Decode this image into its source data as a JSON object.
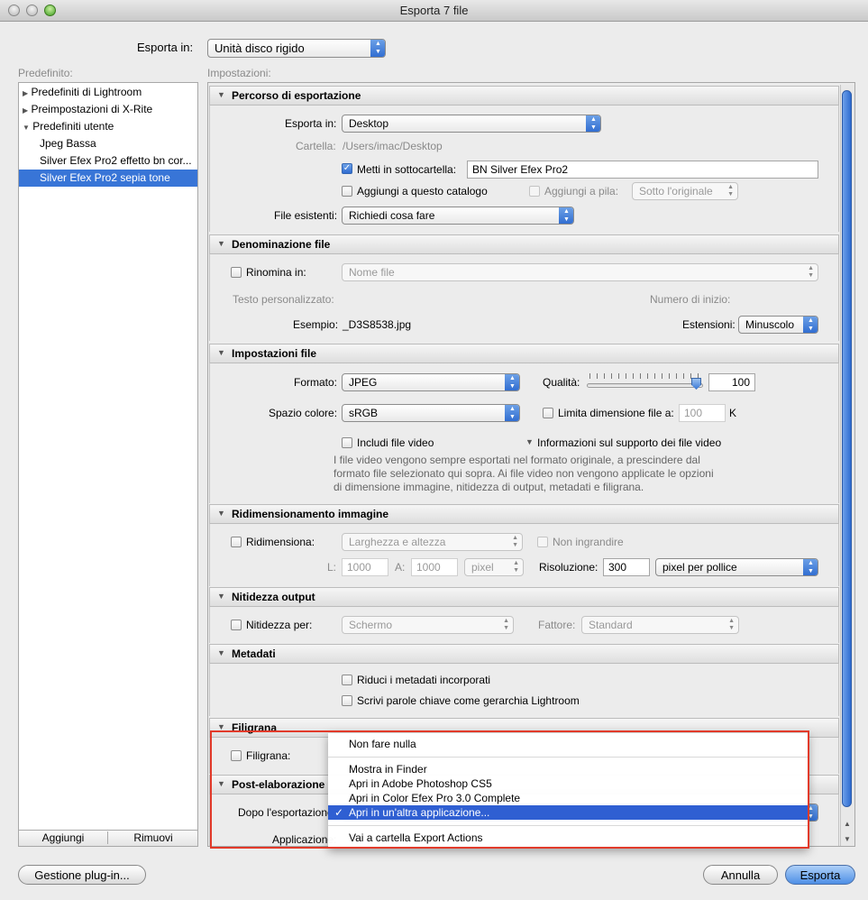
{
  "window": {
    "title": "Esporta 7 file"
  },
  "export_to": {
    "label": "Esporta in:",
    "value": "Unità disco rigido"
  },
  "presets": {
    "header": "Predefinito:",
    "items": [
      {
        "label": "Predefiniti di Lightroom",
        "kind": "folder-closed"
      },
      {
        "label": "Preimpostazioni di X-Rite",
        "kind": "folder-closed"
      },
      {
        "label": "Predefiniti utente",
        "kind": "folder-open"
      },
      {
        "label": "Jpeg Bassa",
        "kind": "item"
      },
      {
        "label": "Silver Efex Pro2 effetto bn cor...",
        "kind": "item"
      },
      {
        "label": "Silver Efex Pro2 sepia tone",
        "kind": "selected"
      }
    ],
    "add_label": "Aggiungi",
    "remove_label": "Rimuovi"
  },
  "settings_header": "Impostazioni:",
  "export_location": {
    "title": "Percorso di esportazione",
    "export_in_label": "Esporta in:",
    "export_in_value": "Desktop",
    "folder_label": "Cartella:",
    "folder_value": "/Users/imac/Desktop",
    "subfolder_label": "Metti in sottocartella:",
    "subfolder_value": "BN Silver Efex Pro2",
    "add_catalog_label": "Aggiungi a questo catalogo",
    "add_stack_label": "Aggiungi a pila:",
    "stack_value": "Sotto l'originale",
    "existing_label": "File esistenti:",
    "existing_value": "Richiedi cosa fare"
  },
  "file_naming": {
    "title": "Denominazione file",
    "rename_label": "Rinomina in:",
    "rename_value": "Nome file",
    "custom_text_label": "Testo personalizzato:",
    "start_number_label": "Numero di inizio:",
    "example_label": "Esempio:",
    "example_value": "_D3S8538.jpg",
    "extensions_label": "Estensioni:",
    "extensions_value": "Minuscolo"
  },
  "file_settings": {
    "title": "Impostazioni file",
    "format_label": "Formato:",
    "format_value": "JPEG",
    "quality_label": "Qualità:",
    "quality_value": "100",
    "quality_fraction": 1.0,
    "colorspace_label": "Spazio colore:",
    "colorspace_value": "sRGB",
    "limit_size_label": "Limita dimensione file a:",
    "limit_size_value": "100",
    "limit_size_unit": "K",
    "include_video_label": "Includi file video",
    "video_info_label": "Informazioni sul supporto dei file video",
    "video_note_line1": "I file video vengono sempre esportati nel formato originale, a prescindere dal",
    "video_note_line2": "formato file selezionato qui sopra. Ai file video non vengono applicate le opzioni",
    "video_note_line3": "di dimensione immagine, nitidezza di output, metadati e filigrana."
  },
  "image_sizing": {
    "title": "Ridimensionamento immagine",
    "resize_label": "Ridimensiona:",
    "resize_value": "Larghezza e altezza",
    "no_enlarge_label": "Non ingrandire",
    "w_label": "L:",
    "w_value": "1000",
    "h_label": "A:",
    "h_value": "1000",
    "unit_value": "pixel",
    "resolution_label": "Risoluzione:",
    "resolution_value": "300",
    "resolution_unit": "pixel per pollice"
  },
  "output_sharpening": {
    "title": "Nitidezza output",
    "sharpen_label": "Nitidezza per:",
    "sharpen_value": "Schermo",
    "amount_label": "Fattore:",
    "amount_value": "Standard"
  },
  "metadata": {
    "title": "Metadati",
    "minimize_label": "Riduci i metadati incorporati",
    "keywords_label": "Scrivi parole chiave come gerarchia Lightroom"
  },
  "watermark": {
    "title": "Filigrana",
    "label": "Filigrana:"
  },
  "post_processing": {
    "title": "Post-elaborazione",
    "after_label": "Dopo l'esportazione:",
    "app_label": "Applicazione:"
  },
  "dropdown_menu": {
    "items": [
      {
        "label": "Non fare nulla",
        "checked": false
      },
      {
        "label": "Mostra in Finder",
        "checked": false
      },
      {
        "label": "Apri in Adobe Photoshop CS5",
        "checked": false
      },
      {
        "label": "Apri in Color Efex Pro 3.0 Complete",
        "checked": false
      },
      {
        "label": "Apri in un'altra applicazione...",
        "checked": true
      },
      {
        "label": "Vai a cartella Export Actions",
        "checked": false
      }
    ],
    "check_glyph": "✓"
  },
  "buttons": {
    "plugin_manager": "Gestione plug-in...",
    "cancel": "Annulla",
    "export": "Esporta"
  },
  "icons": {
    "disclosure_open": "▼",
    "disclosure_closed": "▶",
    "popup_arrows": "▲▼",
    "checkmark": "✓"
  }
}
